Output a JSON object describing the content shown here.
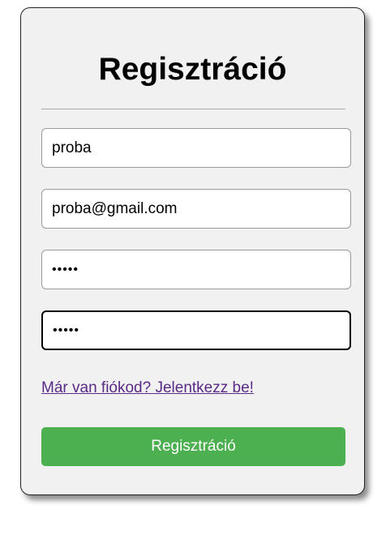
{
  "form": {
    "title": "Regisztráció",
    "username_value": "proba",
    "email_value": "proba@gmail.com",
    "password_value": "proba",
    "password_confirm_value": "proba",
    "login_link": "Már van fiókod? Jelentkezz be!",
    "submit_label": "Regisztráció"
  },
  "colors": {
    "card_background": "#f1f1f1",
    "button_background": "#4caf50",
    "link_color": "#5a2a87"
  }
}
